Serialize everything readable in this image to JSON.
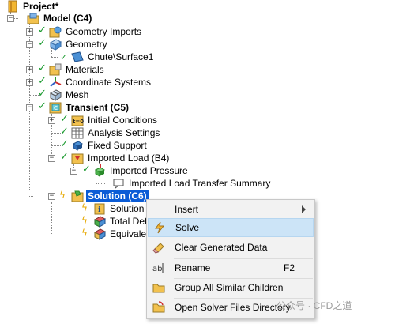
{
  "tree": {
    "project": "Project*",
    "model": "Model (C4)",
    "geometry_imports": "Geometry Imports",
    "geometry": "Geometry",
    "chute_surface": "Chute\\Surface1",
    "materials": "Materials",
    "coordinate_systems": "Coordinate Systems",
    "mesh": "Mesh",
    "transient": "Transient (C5)",
    "initial_conditions": "Initial Conditions",
    "analysis_settings": "Analysis Settings",
    "fixed_support": "Fixed Support",
    "imported_load": "Imported Load (B4)",
    "imported_pressure": "Imported Pressure",
    "transfer_summary": "Imported Load Transfer Summary",
    "solution": "Solution (C6)",
    "solution_info": "Solution In",
    "total_deformation": "Total Defo",
    "equivalent": "Equivalent"
  },
  "context_menu": {
    "insert": "Insert",
    "solve": "Solve",
    "clear_generated_data": "Clear Generated Data",
    "rename": "Rename",
    "rename_shortcut": "F2",
    "group_similar": "Group All Similar Children",
    "open_solver_dir": "Open Solver Files Directory"
  },
  "watermark": "公众号 · CFD之道",
  "colors": {
    "selection": "#0b5cd6",
    "hover": "#cce4f7",
    "check": "#1a9a2e",
    "bolt": "#e6a800"
  }
}
